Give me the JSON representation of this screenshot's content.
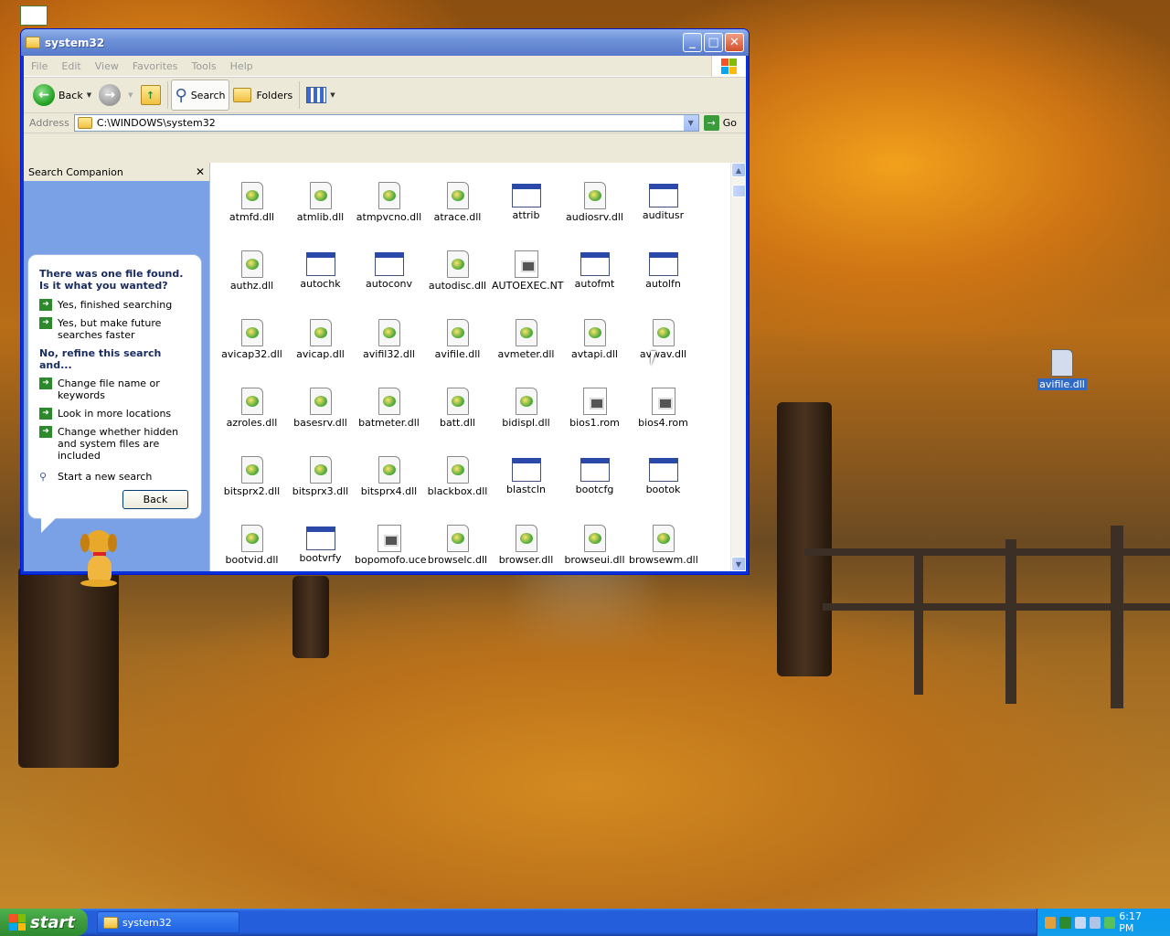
{
  "desktop": {
    "icons": [
      {
        "label": "avifile.dll",
        "selected": true
      }
    ]
  },
  "window": {
    "title": "system32",
    "menu": [
      "File",
      "Edit",
      "View",
      "Favorites",
      "Tools",
      "Help"
    ],
    "toolbar": {
      "back": "Back",
      "search": "Search",
      "folders": "Folders"
    },
    "address": {
      "label": "Address",
      "value": "C:\\WINDOWS\\system32",
      "go": "Go"
    },
    "search_companion": {
      "title": "Search Companion",
      "question": "There was one file found.  Is it what you wanted?",
      "options": [
        "Yes, finished searching",
        "Yes, but make future searches faster"
      ],
      "refine_heading": "No, refine this search and...",
      "refine_options": [
        "Change file name or keywords",
        "Look in more locations",
        "Change whether hidden and system files are included"
      ],
      "new_search": "Start a new search",
      "back_button": "Back"
    },
    "files": [
      {
        "name": "atmfd.dll",
        "type": "dll"
      },
      {
        "name": "atmlib.dll",
        "type": "dll"
      },
      {
        "name": "atmpvcno.dll",
        "type": "dll"
      },
      {
        "name": "atrace.dll",
        "type": "dll"
      },
      {
        "name": "attrib",
        "type": "exe"
      },
      {
        "name": "audiosrv.dll",
        "type": "dll"
      },
      {
        "name": "auditusr",
        "type": "exe"
      },
      {
        "name": "authz.dll",
        "type": "dll"
      },
      {
        "name": "autochk",
        "type": "exe"
      },
      {
        "name": "autoconv",
        "type": "exe"
      },
      {
        "name": "autodisc.dll",
        "type": "dll"
      },
      {
        "name": "AUTOEXEC.NT",
        "type": "sys"
      },
      {
        "name": "autofmt",
        "type": "exe"
      },
      {
        "name": "autolfn",
        "type": "exe"
      },
      {
        "name": "avicap32.dll",
        "type": "dll"
      },
      {
        "name": "avicap.dll",
        "type": "dll"
      },
      {
        "name": "avifil32.dll",
        "type": "dll"
      },
      {
        "name": "avifile.dll",
        "type": "dll"
      },
      {
        "name": "avmeter.dll",
        "type": "dll"
      },
      {
        "name": "avtapi.dll",
        "type": "dll"
      },
      {
        "name": "avwav.dll",
        "type": "dll"
      },
      {
        "name": "azroles.dll",
        "type": "dll"
      },
      {
        "name": "basesrv.dll",
        "type": "dll"
      },
      {
        "name": "batmeter.dll",
        "type": "dll"
      },
      {
        "name": "batt.dll",
        "type": "dll"
      },
      {
        "name": "bidispl.dll",
        "type": "dll"
      },
      {
        "name": "bios1.rom",
        "type": "sys"
      },
      {
        "name": "bios4.rom",
        "type": "sys"
      },
      {
        "name": "bitsprx2.dll",
        "type": "dll"
      },
      {
        "name": "bitsprx3.dll",
        "type": "dll"
      },
      {
        "name": "bitsprx4.dll",
        "type": "dll"
      },
      {
        "name": "blackbox.dll",
        "type": "dll"
      },
      {
        "name": "blastcln",
        "type": "exe"
      },
      {
        "name": "bootcfg",
        "type": "exe"
      },
      {
        "name": "bootok",
        "type": "exe"
      },
      {
        "name": "bootvid.dll",
        "type": "dll"
      },
      {
        "name": "bootvrfy",
        "type": "exe"
      },
      {
        "name": "bopomofo.uce",
        "type": "sys"
      },
      {
        "name": "browselc.dll",
        "type": "dll"
      },
      {
        "name": "browser.dll",
        "type": "dll"
      },
      {
        "name": "browseui.dll",
        "type": "dll"
      },
      {
        "name": "browsewm.dll",
        "type": "dll"
      }
    ]
  },
  "taskbar": {
    "start": "start",
    "tasks": [
      "system32"
    ],
    "clock": "6:17 PM"
  }
}
